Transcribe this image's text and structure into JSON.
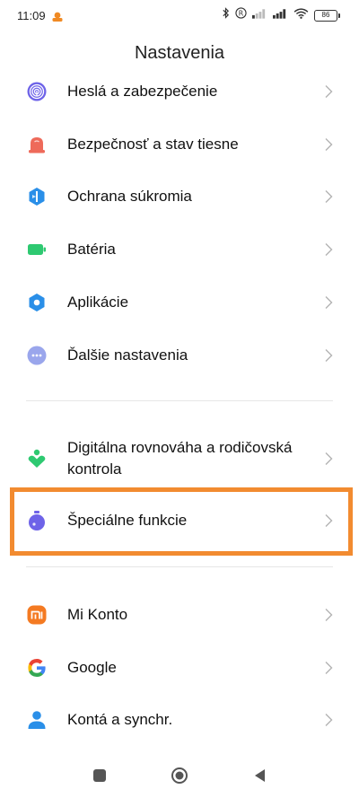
{
  "status_bar": {
    "time": "11:09",
    "battery": "86"
  },
  "header": {
    "title": "Nastavenia"
  },
  "settings": {
    "items": [
      {
        "label": "Heslá a zabezpečenie",
        "icon": "fingerprint-icon",
        "color": "#6e63e8"
      },
      {
        "label": "Bezpečnosť a stav tiesne",
        "icon": "alarm-bell-icon",
        "color": "#ee6a5a"
      },
      {
        "label": "Ochrana súkromia",
        "icon": "privacy-shield-icon",
        "color": "#2a8fe8"
      },
      {
        "label": "Batéria",
        "icon": "battery-icon",
        "color": "#2ec971"
      },
      {
        "label": "Aplikácie",
        "icon": "gear-icon",
        "color": "#2a8fe8"
      },
      {
        "label": "Ďalšie nastavenia",
        "icon": "more-dots-icon",
        "color": "#9aa6ec"
      },
      {
        "label": "Digitálna rovnováha a rodičovská kontrola",
        "icon": "heart-person-icon",
        "color": "#2ec971"
      },
      {
        "label": "Špeciálne funkcie",
        "icon": "special-features-icon",
        "color": "#6e63e8"
      },
      {
        "label": "Mi Konto",
        "icon": "mi-logo-icon",
        "color": "#f47a22"
      },
      {
        "label": "Google",
        "icon": "google-icon",
        "color": "#4285f4"
      },
      {
        "label": "Kontá a synchr.",
        "icon": "account-icon",
        "color": "#2a8fe8"
      }
    ]
  },
  "highlight_color": "#f28b30"
}
